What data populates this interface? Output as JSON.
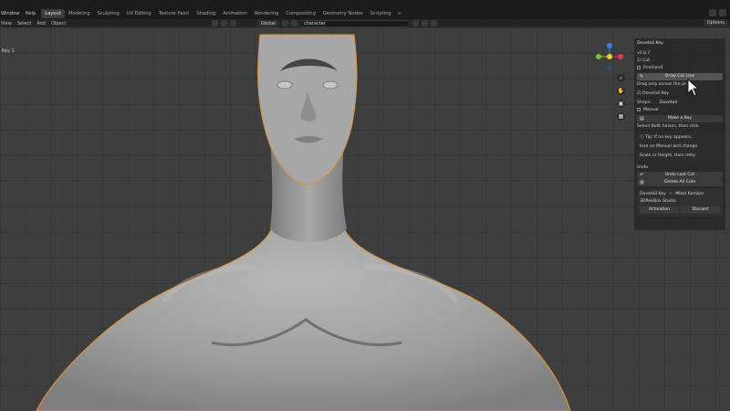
{
  "topbar": {
    "menu": [
      "Window",
      "Help"
    ],
    "tabs": [
      "Layout",
      "Modeling",
      "Sculpting",
      "UV Editing",
      "Texture Paint",
      "Shading",
      "Animation",
      "Rendering",
      "Compositing",
      "Geometry Nodes",
      "Scripting",
      "+"
    ],
    "active_tab": "Layout"
  },
  "header": {
    "menu": [
      "View",
      "Select",
      "Add",
      "Object"
    ],
    "orientation": "Global",
    "search_value": "character",
    "options_label": "Options"
  },
  "viewport": {
    "label": "Key 1"
  },
  "panel": {
    "title": "Dovetail Key",
    "version": "v2.6.7",
    "section1": "1) Cut",
    "freehand": "Freehand",
    "draw_cut_line": "Draw Cut Line",
    "hint1": "Drag only across the pr...",
    "section2": "2) Dovetail Key",
    "shape_label": "Shape:",
    "shape_value": "Dovetail",
    "manual": "Manual",
    "make_key": "Make a Key",
    "hint2": "Select Both halves, then click",
    "tip1": "Tip: If no key appears,",
    "tip2": "turn on Manual and change",
    "tip3": "Scale or Height, then retry.",
    "undo_label": "Undo",
    "undo_last_cut": "Undo Last Cut",
    "delete_all_cuts": "Delete All Cuts",
    "footer_title": "Dovetail Key",
    "footer_author": "Mikel Kambor",
    "footer_studio": "3DReeBox Studio",
    "activation": "Activation",
    "discord": "Discord"
  },
  "colors": {
    "selection_outline": "#e0913a",
    "active_tab": "#3d3d3d",
    "gizmo_x": "#e23a4a",
    "gizmo_y": "#7cc62a",
    "gizmo_z": "#3a7ee8"
  }
}
